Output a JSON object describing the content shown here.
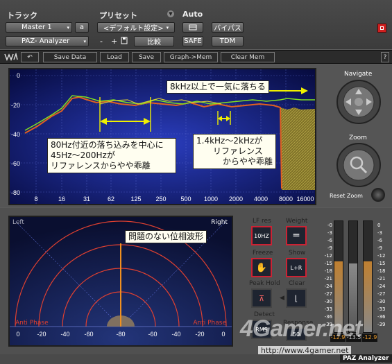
{
  "protools": {
    "track_label": "トラック",
    "preset_label": "プリセット",
    "auto_label": "Auto",
    "track_name": "Master 1",
    "track_channel": "a",
    "preset_value": "<デフォルト設定>",
    "plugin_name": "PAZ- Analyzer",
    "minus": "-",
    "plus": "+",
    "compare": "比較",
    "bypass": "バイパス",
    "safe": "SAFE",
    "tdm": "TDM"
  },
  "waves_toolbar": {
    "save_data": "Save Data",
    "load": "Load",
    "save": "Save",
    "graph_mem": "Graph->Mem",
    "clear_mem": "Clear Mem",
    "help": "?"
  },
  "spectrum": {
    "y_ticks": [
      "0",
      "-20",
      "-40",
      "-60",
      "-80"
    ],
    "x_ticks": [
      "8",
      "16",
      "31",
      "62",
      "125",
      "250",
      "500",
      "1000",
      "2000",
      "4000",
      "8000",
      "16000"
    ],
    "callout_8k": "8kHz以上で一気に落ちる",
    "callout_80hz_lines": [
      "80Hz付近の落ち込みを中心に",
      "45Hz～200Hzが",
      "リファレンスからやや乖離"
    ],
    "callout_1k_lines": [
      "1.4kHz～2kHzが",
      "リファレンス",
      "からやや乖離"
    ]
  },
  "navigate": {
    "navigate_label": "Navigate",
    "zoom_label": "Zoom",
    "reset_label": "Reset Zoom"
  },
  "phase": {
    "left": "Left",
    "right": "Right",
    "anti_left": "Anti Phase",
    "anti_right": "Anti Phase",
    "callout": "問題のない位相波形",
    "x_ticks": [
      "0",
      "-20",
      "-40",
      "-60",
      "-80",
      "-60",
      "-40",
      "-20",
      "0"
    ]
  },
  "controls": {
    "lf_res": "LF res",
    "lf_res_value": "10HZ",
    "weight": "Weight",
    "freeze": "Freeze",
    "show": "Show",
    "show_value": "L+R",
    "peak_hold": "Peak Hold",
    "clear": "Clear",
    "detect": "Detect",
    "detect_value": "RMS",
    "response": "Response",
    "response_value": "50"
  },
  "meters": {
    "scale": [
      "-0",
      "-3",
      "-6",
      "-9",
      "-12",
      "-15",
      "-18",
      "-21",
      "-24",
      "-27",
      "-30",
      "-33",
      "-36",
      "-39"
    ],
    "scale_right": [
      "0",
      "-3",
      "-6",
      "-9",
      "-12",
      "-15",
      "-18",
      "-21",
      "-24",
      "-27",
      "-30",
      "-33",
      "-36",
      "-39"
    ],
    "peak_left": "-12.9",
    "peak_right": "-12.9",
    "rms_value": "-13.5"
  },
  "footer": {
    "brand": "PAZ Analyzer",
    "watermark": "4Gamer.net",
    "watermark_url": "http://www.4gamer.net"
  }
}
